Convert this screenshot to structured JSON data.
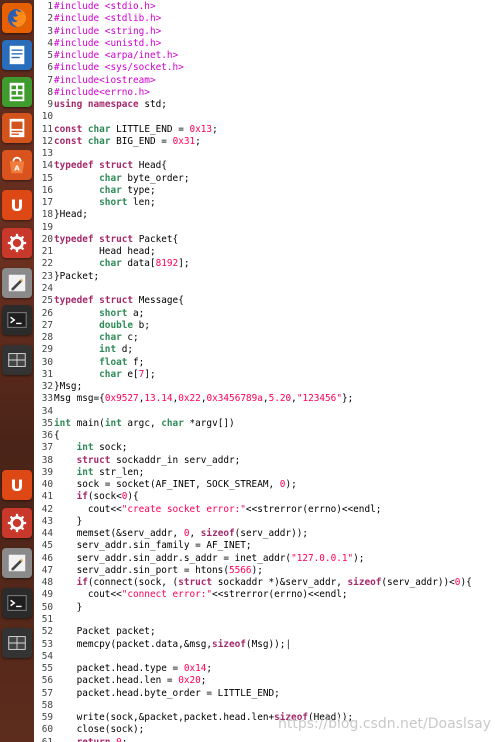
{
  "launcher": {
    "background": "#5a2a1c",
    "items": [
      {
        "name": "firefox-icon",
        "color": "#e66000"
      },
      {
        "name": "writer-icon",
        "color": "#2a6ebb"
      },
      {
        "name": "calc-icon",
        "color": "#3f9b2e"
      },
      {
        "name": "impress-icon",
        "color": "#d2541c"
      },
      {
        "name": "software-center-icon",
        "color": "#d9531e"
      },
      {
        "name": "ubuntu-one-icon",
        "color": "#dd4814",
        "glyph": "U"
      },
      {
        "name": "system-settings-icon",
        "color": "#c8392b"
      },
      {
        "name": "text-editor-icon",
        "color": "#8a8a8a"
      },
      {
        "name": "terminal-icon",
        "color": "#2b2b2b"
      },
      {
        "name": "workspace-switcher-icon",
        "color": "#333333"
      },
      {
        "name": "ubuntu-one-icon-2",
        "color": "#dd4814",
        "glyph": "U"
      },
      {
        "name": "system-settings-icon-2",
        "color": "#c8392b"
      },
      {
        "name": "text-editor-icon-2",
        "color": "#8a8a8a"
      },
      {
        "name": "terminal-icon-2",
        "color": "#2b2b2b"
      },
      {
        "name": "workspace-switcher-icon-2",
        "color": "#333333"
      }
    ]
  },
  "editor": {
    "lines": [
      [
        [
          "pp",
          "#include <stdio.h>"
        ]
      ],
      [
        [
          "pp",
          "#include <stdlib.h>"
        ]
      ],
      [
        [
          "pp",
          "#include <string.h>"
        ]
      ],
      [
        [
          "pp",
          "#include <unistd.h>"
        ]
      ],
      [
        [
          "pp",
          "#include <arpa/inet.h>"
        ]
      ],
      [
        [
          "pp",
          "#include <sys/socket.h>"
        ]
      ],
      [
        [
          "pp",
          "#include<iostream>"
        ]
      ],
      [
        [
          "pp",
          "#include<errno.h>"
        ]
      ],
      [
        [
          "kw",
          "using"
        ],
        [
          "t",
          " "
        ],
        [
          "kw",
          "namespace"
        ],
        [
          "t",
          " std;"
        ]
      ],
      [],
      [
        [
          "kw",
          "const"
        ],
        [
          "t",
          " "
        ],
        [
          "kt",
          "char"
        ],
        [
          "t",
          " LITTLE_END = "
        ],
        [
          "num",
          "0x13"
        ],
        [
          "t",
          ";"
        ]
      ],
      [
        [
          "kw",
          "const"
        ],
        [
          "t",
          " "
        ],
        [
          "kt",
          "char"
        ],
        [
          "t",
          " BIG_END = "
        ],
        [
          "num",
          "0x31"
        ],
        [
          "t",
          ";"
        ]
      ],
      [],
      [
        [
          "kw",
          "typedef"
        ],
        [
          "t",
          " "
        ],
        [
          "kw",
          "struct"
        ],
        [
          "t",
          " Head{"
        ]
      ],
      [
        [
          "t",
          "        "
        ],
        [
          "kt",
          "char"
        ],
        [
          "t",
          " byte_order;"
        ]
      ],
      [
        [
          "t",
          "        "
        ],
        [
          "kt",
          "char"
        ],
        [
          "t",
          " type;"
        ]
      ],
      [
        [
          "t",
          "        "
        ],
        [
          "kt",
          "short"
        ],
        [
          "t",
          " len;"
        ]
      ],
      [
        [
          "t",
          "}Head;"
        ]
      ],
      [],
      [
        [
          "kw",
          "typedef"
        ],
        [
          "t",
          " "
        ],
        [
          "kw",
          "struct"
        ],
        [
          "t",
          " Packet{"
        ]
      ],
      [
        [
          "t",
          "        Head head;"
        ]
      ],
      [
        [
          "t",
          "        "
        ],
        [
          "kt",
          "char"
        ],
        [
          "t",
          " data["
        ],
        [
          "num",
          "8192"
        ],
        [
          "t",
          "];"
        ]
      ],
      [
        [
          "t",
          "}Packet;"
        ]
      ],
      [],
      [
        [
          "kw",
          "typedef"
        ],
        [
          "t",
          " "
        ],
        [
          "kw",
          "struct"
        ],
        [
          "t",
          " Message{"
        ]
      ],
      [
        [
          "t",
          "        "
        ],
        [
          "kt",
          "short"
        ],
        [
          "t",
          " a;"
        ]
      ],
      [
        [
          "t",
          "        "
        ],
        [
          "kt",
          "double"
        ],
        [
          "t",
          " b;"
        ]
      ],
      [
        [
          "t",
          "        "
        ],
        [
          "kt",
          "char"
        ],
        [
          "t",
          " c;"
        ]
      ],
      [
        [
          "t",
          "        "
        ],
        [
          "kt",
          "int"
        ],
        [
          "t",
          " d;"
        ]
      ],
      [
        [
          "t",
          "        "
        ],
        [
          "kt",
          "float"
        ],
        [
          "t",
          " f;"
        ]
      ],
      [
        [
          "t",
          "        "
        ],
        [
          "kt",
          "char"
        ],
        [
          "t",
          " e["
        ],
        [
          "num",
          "7"
        ],
        [
          "t",
          "];"
        ]
      ],
      [
        [
          "t",
          "}Msg;"
        ]
      ],
      [
        [
          "t",
          "Msg msg={"
        ],
        [
          "num",
          "0x9527"
        ],
        [
          "t",
          ","
        ],
        [
          "num",
          "13.14"
        ],
        [
          "t",
          ","
        ],
        [
          "num",
          "0x22"
        ],
        [
          "t",
          ","
        ],
        [
          "num",
          "0x3456789a"
        ],
        [
          "t",
          ","
        ],
        [
          "num",
          "5.20"
        ],
        [
          "t",
          ","
        ],
        [
          "str",
          "\"123456\""
        ],
        [
          "t",
          "};"
        ]
      ],
      [],
      [
        [
          "kt",
          "int"
        ],
        [
          "t",
          " main("
        ],
        [
          "kt",
          "int"
        ],
        [
          "t",
          " argc, "
        ],
        [
          "kt",
          "char"
        ],
        [
          "t",
          " *argv[])"
        ]
      ],
      [
        [
          "t",
          "{"
        ]
      ],
      [
        [
          "t",
          "    "
        ],
        [
          "kt",
          "int"
        ],
        [
          "t",
          " sock;"
        ]
      ],
      [
        [
          "t",
          "    "
        ],
        [
          "kw",
          "struct"
        ],
        [
          "t",
          " sockaddr_in serv_addr;"
        ]
      ],
      [
        [
          "t",
          "    "
        ],
        [
          "kt",
          "int"
        ],
        [
          "t",
          " str_len;"
        ]
      ],
      [
        [
          "t",
          "    sock = socket(AF_INET, SOCK_STREAM, "
        ],
        [
          "num",
          "0"
        ],
        [
          "t",
          ");"
        ]
      ],
      [
        [
          "t",
          "    "
        ],
        [
          "kw",
          "if"
        ],
        [
          "t",
          "(sock<"
        ],
        [
          "num",
          "0"
        ],
        [
          "t",
          "){"
        ]
      ],
      [
        [
          "t",
          "      cout<<"
        ],
        [
          "str",
          "\"create socket error:\""
        ],
        [
          "t",
          "<<strerror(errno)<<endl;"
        ]
      ],
      [
        [
          "t",
          "    }"
        ]
      ],
      [
        [
          "t",
          "    memset(&serv_addr, "
        ],
        [
          "num",
          "0"
        ],
        [
          "t",
          ", "
        ],
        [
          "kw",
          "sizeof"
        ],
        [
          "t",
          "(serv_addr));"
        ]
      ],
      [
        [
          "t",
          "    serv_addr.sin_family = AF_INET;"
        ]
      ],
      [
        [
          "t",
          "    serv_addr.sin_addr.s_addr = inet_addr("
        ],
        [
          "str",
          "\"127.0.0.1\""
        ],
        [
          "t",
          ");"
        ]
      ],
      [
        [
          "t",
          "    serv_addr.sin_port = htons("
        ],
        [
          "num",
          "5566"
        ],
        [
          "t",
          ");"
        ]
      ],
      [
        [
          "t",
          "    "
        ],
        [
          "kw",
          "if"
        ],
        [
          "t",
          "(connect(sock, ("
        ],
        [
          "kw",
          "struct"
        ],
        [
          "t",
          " sockaddr *)&serv_addr, "
        ],
        [
          "kw",
          "sizeof"
        ],
        [
          "t",
          "(serv_addr))<"
        ],
        [
          "num",
          "0"
        ],
        [
          "t",
          "){"
        ]
      ],
      [
        [
          "t",
          "      cout<<"
        ],
        [
          "str",
          "\"connect error:\""
        ],
        [
          "t",
          "<<strerror(errno)<<endl;"
        ]
      ],
      [
        [
          "t",
          "    }"
        ]
      ],
      [],
      [
        [
          "t",
          "    Packet packet;"
        ]
      ],
      [
        [
          "t",
          "    memcpy(packet.data,&msg,"
        ],
        [
          "kw",
          "sizeof"
        ],
        [
          "t",
          "(Msg));"
        ],
        [
          "cur",
          "|"
        ]
      ],
      [],
      [
        [
          "t",
          "    packet.head.type = "
        ],
        [
          "num",
          "0x14"
        ],
        [
          "t",
          ";"
        ]
      ],
      [
        [
          "t",
          "    packet.head.len = "
        ],
        [
          "num",
          "0x20"
        ],
        [
          "t",
          ";"
        ]
      ],
      [
        [
          "t",
          "    packet.head.byte_order = LITTLE_END;"
        ]
      ],
      [],
      [
        [
          "t",
          "    write(sock,&packet,packet.head.len+"
        ],
        [
          "kw",
          "sizeof"
        ],
        [
          "t",
          "(Head));"
        ]
      ],
      [
        [
          "t",
          "    close(sock);"
        ]
      ],
      [
        [
          "t",
          "    "
        ],
        [
          "kw",
          "return"
        ],
        [
          "t",
          " "
        ],
        [
          "num",
          "0"
        ],
        [
          "t",
          ";"
        ]
      ],
      [
        [
          "t",
          "}"
        ]
      ]
    ]
  },
  "watermark": "https://blog.csdn.net/Doaslsay"
}
